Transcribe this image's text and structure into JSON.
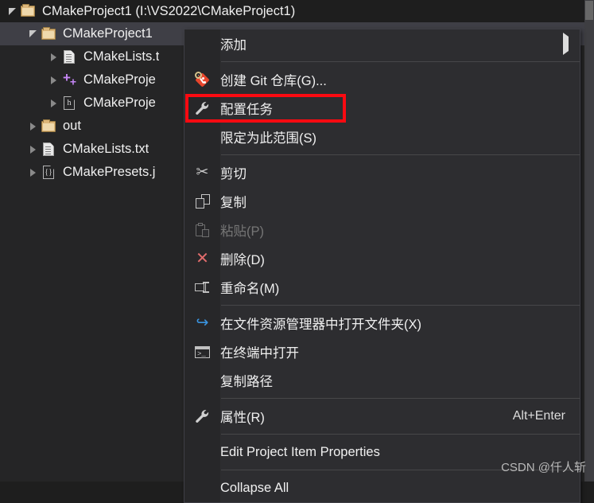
{
  "tree": {
    "root": {
      "label": "CMakeProject1 (I:\\VS2022\\CMakeProject1)",
      "icon": "folder-icon",
      "expander": "expander-open-icon"
    },
    "items": [
      {
        "label": "CMakeProject1",
        "icon": "folder-icon",
        "expander": "expander-open-icon",
        "selected": true,
        "depth": 1
      },
      {
        "label": "CMakeLists.t",
        "icon": "text-document-icon",
        "expander": "expander-closed-icon",
        "selected": false,
        "depth": 2
      },
      {
        "label": "CMakeProje",
        "icon": "cpp-source-icon",
        "expander": "expander-closed-icon",
        "selected": false,
        "depth": 2
      },
      {
        "label": "CMakeProje",
        "icon": "header-file-icon",
        "expander": "expander-closed-icon",
        "selected": false,
        "depth": 2
      },
      {
        "label": "out",
        "icon": "folder-icon",
        "expander": "expander-closed-icon",
        "selected": false,
        "depth": 1
      },
      {
        "label": "CMakeLists.txt",
        "icon": "text-document-icon",
        "expander": "expander-closed-icon",
        "selected": false,
        "depth": 1
      },
      {
        "label": "CMakePresets.j",
        "icon": "json-file-icon",
        "expander": "expander-closed-icon",
        "selected": false,
        "depth": 1
      }
    ]
  },
  "context_menu": {
    "items": [
      {
        "label": "添加",
        "icon": null,
        "shortcut": "",
        "submenu": true,
        "disabled": false,
        "highlighted": false
      },
      {
        "separator": true
      },
      {
        "label": "创建 Git 仓库(G)...",
        "icon": "git-repository-icon",
        "shortcut": "",
        "submenu": false,
        "disabled": false,
        "highlighted": false
      },
      {
        "label": "配置任务",
        "icon": "wrench-icon",
        "shortcut": "",
        "submenu": false,
        "disabled": false,
        "highlighted": true
      },
      {
        "label": "限定为此范围(S)",
        "icon": null,
        "shortcut": "",
        "submenu": false,
        "disabled": false,
        "highlighted": false
      },
      {
        "separator": true
      },
      {
        "label": "剪切",
        "icon": "scissors-icon",
        "shortcut": "",
        "submenu": false,
        "disabled": false,
        "highlighted": false
      },
      {
        "label": "复制",
        "icon": "copy-icon",
        "shortcut": "",
        "submenu": false,
        "disabled": false,
        "highlighted": false
      },
      {
        "label": "粘贴(P)",
        "icon": "paste-icon",
        "shortcut": "",
        "submenu": false,
        "disabled": true,
        "highlighted": false
      },
      {
        "label": "删除(D)",
        "icon": "delete-x-icon",
        "shortcut": "",
        "submenu": false,
        "disabled": false,
        "highlighted": false
      },
      {
        "label": "重命名(M)",
        "icon": "rename-icon",
        "shortcut": "",
        "submenu": false,
        "disabled": false,
        "highlighted": false
      },
      {
        "separator": true
      },
      {
        "label": "在文件资源管理器中打开文件夹(X)",
        "icon": "open-folder-arrow-icon",
        "shortcut": "",
        "submenu": false,
        "disabled": false,
        "highlighted": false
      },
      {
        "label": "在终端中打开",
        "icon": "terminal-icon",
        "shortcut": "",
        "submenu": false,
        "disabled": false,
        "highlighted": false
      },
      {
        "label": "复制路径",
        "icon": null,
        "shortcut": "",
        "submenu": false,
        "disabled": false,
        "highlighted": false
      },
      {
        "separator": true
      },
      {
        "label": "属性(R)",
        "icon": "wrench-icon",
        "shortcut": "Alt+Enter",
        "submenu": false,
        "disabled": false,
        "highlighted": false
      },
      {
        "separator": true
      },
      {
        "label": "Edit Project Item Properties",
        "icon": null,
        "shortcut": "",
        "submenu": false,
        "disabled": false,
        "highlighted": false
      },
      {
        "separator": true
      },
      {
        "label": "Collapse All",
        "icon": null,
        "shortcut": "",
        "submenu": false,
        "disabled": false,
        "highlighted": false
      }
    ]
  },
  "annotation": {
    "highlight_color": "#fb0a11",
    "target_label": "配置任务"
  },
  "watermark": {
    "text": "CSDN @仟人斩"
  },
  "colors": {
    "tree_background": "#252526",
    "root_background": "#1e1e1e",
    "selection_background": "#3f3f46",
    "menu_background": "#2d2d30",
    "menu_gutter": "#272729",
    "menu_border": "#3f3f46",
    "text": "#f0f0f0",
    "disabled_text": "#767676",
    "folder_icon": "#dcb67a",
    "cpp_icon": "#c586f5",
    "delete_icon": "#e06c6c",
    "git_icon": "#e8452c",
    "link_icon": "#3a94e0"
  }
}
